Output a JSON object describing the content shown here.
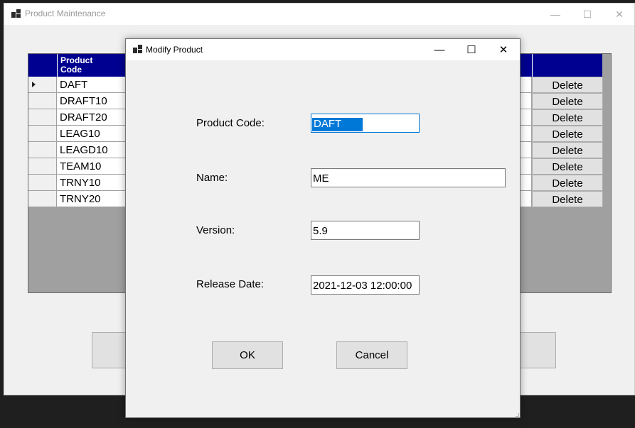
{
  "main_window": {
    "title": "Product Maintenance",
    "controls": {
      "minimize": "—",
      "maximize": "☐",
      "close": "✕"
    }
  },
  "grid": {
    "header_code": "Product\nCode",
    "rows": [
      {
        "code": "DAFT",
        "action": "Delete",
        "current": true
      },
      {
        "code": "DRAFT10",
        "action": "Delete"
      },
      {
        "code": "DRAFT20",
        "action": "Delete"
      },
      {
        "code": "LEAG10",
        "action": "Delete"
      },
      {
        "code": "LEAGD10",
        "action": "Delete"
      },
      {
        "code": "TEAM10",
        "action": "Delete"
      },
      {
        "code": "TRNY10",
        "action": "Delete"
      },
      {
        "code": "TRNY20",
        "action": "Delete"
      }
    ]
  },
  "dialog": {
    "title": "Modify Product",
    "controls": {
      "minimize": "—",
      "maximize": "☐",
      "close": "✕"
    },
    "fields": {
      "product_code_label": "Product Code:",
      "product_code_value": "DAFT",
      "name_label": "Name:",
      "name_value": "ME",
      "version_label": "Version:",
      "version_value": "5.9",
      "release_date_label": "Release Date:",
      "release_date_value": "2021-12-03 12:00:00"
    },
    "ok_label": "OK",
    "cancel_label": "Cancel"
  },
  "colors": {
    "grid_header": "#000090",
    "selection": "#0078d7",
    "window_bg": "#f0f0f0"
  }
}
